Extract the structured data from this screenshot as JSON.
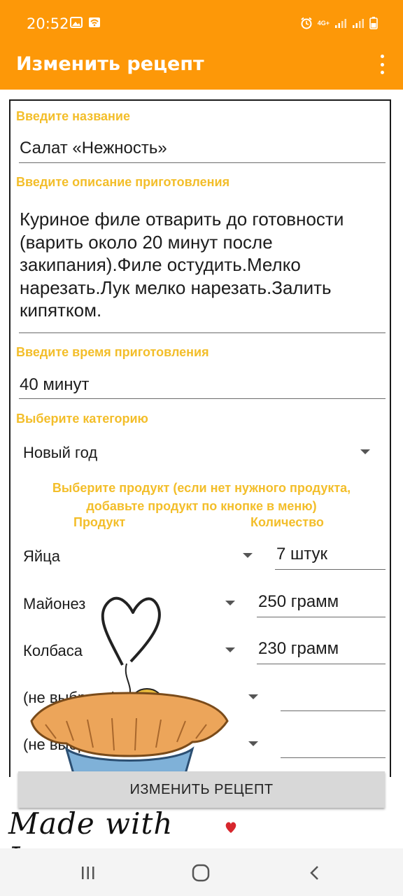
{
  "status_bar": {
    "time": "20:52",
    "signal_label": "4G+"
  },
  "app_bar": {
    "title": "Изменить рецепт"
  },
  "form": {
    "name_label": "Введите название",
    "name_value": "Салат «Нежность»",
    "description_label": "Введите описание приготовления",
    "description_lines": [
      "Куриное филе отварить до готовности",
      "(варить около 20 минут после",
      "закипания).Филе остудить.Мелко",
      "нарезать.Лук мелко нарезать.Залить",
      "кипятком."
    ],
    "time_label": "Введите время приготовления",
    "time_value": "40 минут",
    "category_label": "Выберите категорию",
    "category_value": "Новый год",
    "product_hint_line1": "Выберите продукт (если нет нужного продукта,",
    "product_hint_line2": "добавьте продукт по кнопке в меню)",
    "col_product": "Продукт",
    "col_quantity": "Количество",
    "products": [
      {
        "product": "Яйца",
        "quantity": "7 штук"
      },
      {
        "product": "Майонез",
        "quantity": "250 грамм"
      },
      {
        "product": "Колбаса",
        "quantity": "230 грамм"
      },
      {
        "product": "(не выбрано)",
        "quantity": ""
      },
      {
        "product": "(не выбрано)",
        "quantity": ""
      }
    ]
  },
  "submit_button": "ИЗМЕНИТЬ РЕЦЕПТ",
  "decoration": {
    "made_with_love": "Made with Love"
  },
  "colors": {
    "accent": "#fd9808",
    "label": "#f3be2a",
    "button_bg": "#d8d8d8"
  }
}
